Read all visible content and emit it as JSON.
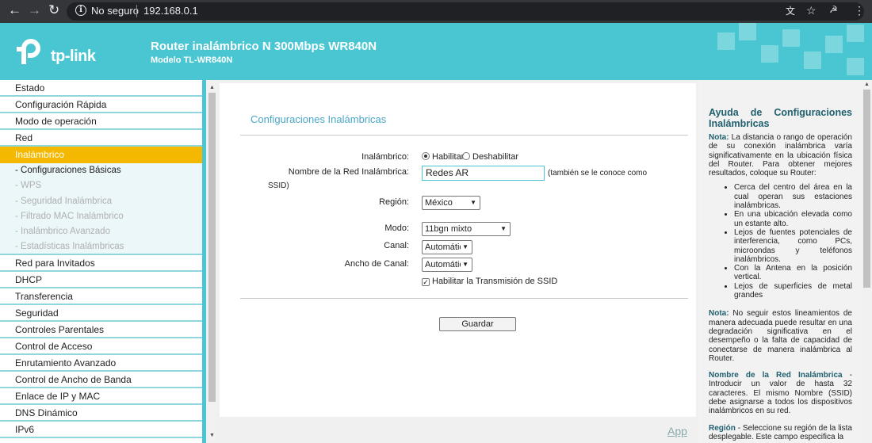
{
  "browser": {
    "security_label": "No seguro",
    "address": "192.168.0.1"
  },
  "header": {
    "brand": "tp-link",
    "title": "Router inalámbrico N 300Mbps WR840N",
    "model": "Modelo TL-WR840N"
  },
  "sidebar": {
    "items_top": [
      "Estado",
      "Configuración Rápida",
      "Modo de operación",
      "Red"
    ],
    "active": "Inalámbrico",
    "subitems": [
      "- Configuraciones Básicas",
      "- WPS",
      "- Seguridad Inalámbrica",
      "- Filtrado MAC Inalámbrico",
      "- Inalámbrico Avanzado",
      "- Estadísticas Inalámbricas"
    ],
    "items_bottom": [
      "Red para Invitados",
      "DHCP",
      "Transferencia",
      "Seguridad",
      "Controles Parentales",
      "Control de Acceso",
      "Enrutamiento Avanzado",
      "Control de Ancho de Banda",
      "Enlace de IP y MAC",
      "DNS Dinámico",
      "IPv6"
    ]
  },
  "main": {
    "title": "Configuraciones Inalámbricas",
    "wireless_label": "Inalámbrico:",
    "enable": "Habilitar",
    "disable": "Deshabilitar",
    "ssid_label": "Nombre de la Red Inalámbrica:",
    "ssid_value": "Redes AR",
    "ssid_note_1": "(también se le conoce como",
    "ssid_note_2": "SSID)",
    "region_label": "Región:",
    "region_value": "México",
    "mode_label": "Modo:",
    "mode_value": "11bgn mixto",
    "channel_label": "Canal:",
    "channel_value": "Automático",
    "width_label": "Ancho de Canal:",
    "width_value": "Automático",
    "broadcast_label": "Habilitar la Transmisión de SSID",
    "save": "Guardar",
    "app_link": "App"
  },
  "help": {
    "title": "Ayuda de Configuraciones Inalámbricas",
    "note_label": "Nota:",
    "note1": "La distancia o rango de operación de su conexión inalámbrica varía significativamente en la ubicación física del Router. Para obtener mejores resultados, coloque su Router:",
    "tips": [
      "Cerca del centro del área en la cual operan sus estaciones inalámbricas.",
      "En una ubicación elevada como un estante alto.",
      "Lejos de fuentes potenciales de interferencia, como PCs, microondas y teléfonos inalámbricos.",
      "Con la Antena en la posición vertical.",
      "Lejos de superficies de metal grandes"
    ],
    "note2": "No seguir estos lineamientos de manera adecuada puede resultar en una degradación significativa en el desempeño o la falta de capacidad de conectarse de manera inalámbrica al Router.",
    "ssid_head": "Nombre de la Red Inalámbrica",
    "ssid_text": "- Introducir un valor de hasta 32 caracteres. El mismo Nombre (SSID) debe asignarse a todos los dispositivos inalámbricos en su red.",
    "region_head": "Región",
    "region_text": "- Seleccione su región de la lista desplegable. Este campo especifica la"
  }
}
